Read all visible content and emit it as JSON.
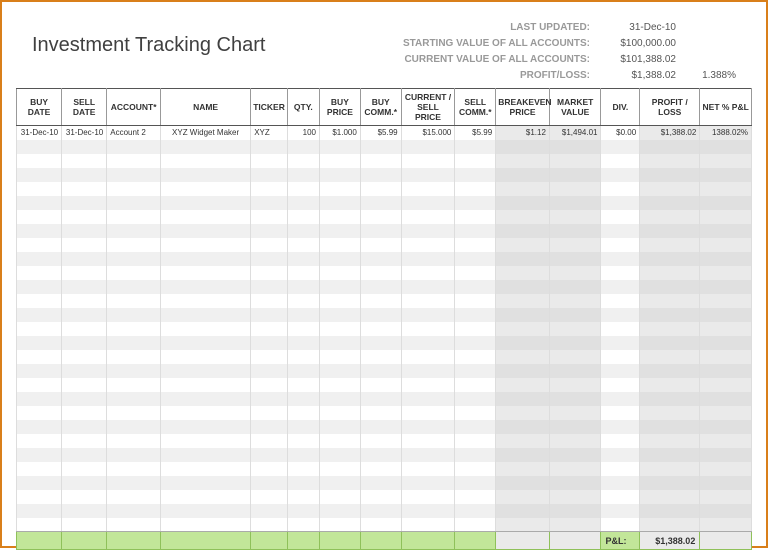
{
  "title": "Investment Tracking Chart",
  "summary": {
    "last_updated_label": "LAST UPDATED:",
    "last_updated_value": "31-Dec-10",
    "starting_label": "STARTING VALUE OF ALL ACCOUNTS:",
    "starting_value": "$100,000.00",
    "current_label": "CURRENT VALUE OF ALL ACCOUNTS:",
    "current_value": "$101,388.02",
    "pl_label": "PROFIT/LOSS:",
    "pl_value": "$1,388.02",
    "pl_pct": "1.388%"
  },
  "columns": [
    "BUY DATE",
    "SELL DATE",
    "ACCOUNT*",
    "NAME",
    "TICKER",
    "QTY.",
    "BUY PRICE",
    "BUY COMM.*",
    "CURRENT / SELL PRICE",
    "SELL COMM.*",
    "BREAKEVEN PRICE",
    "MARKET VALUE",
    "DIV.",
    "PROFIT / LOSS",
    "NET % P&L"
  ],
  "rows": [
    {
      "buy_date": "31-Dec-10",
      "sell_date": "31-Dec-10",
      "account": "Account 2",
      "name": "XYZ Widget Maker",
      "ticker": "XYZ",
      "qty": "100",
      "buy_price": "$1.000",
      "buy_comm": "$5.99",
      "current": "$15.000",
      "sell_comm": "$5.99",
      "breakeven": "$1.12",
      "market": "$1,494.01",
      "div": "$0.00",
      "pl": "$1,388.02",
      "net_pct": "1388.02%"
    }
  ],
  "footer": {
    "label": "P&L:",
    "value": "$1,388.02"
  },
  "blank_row_count": 28
}
